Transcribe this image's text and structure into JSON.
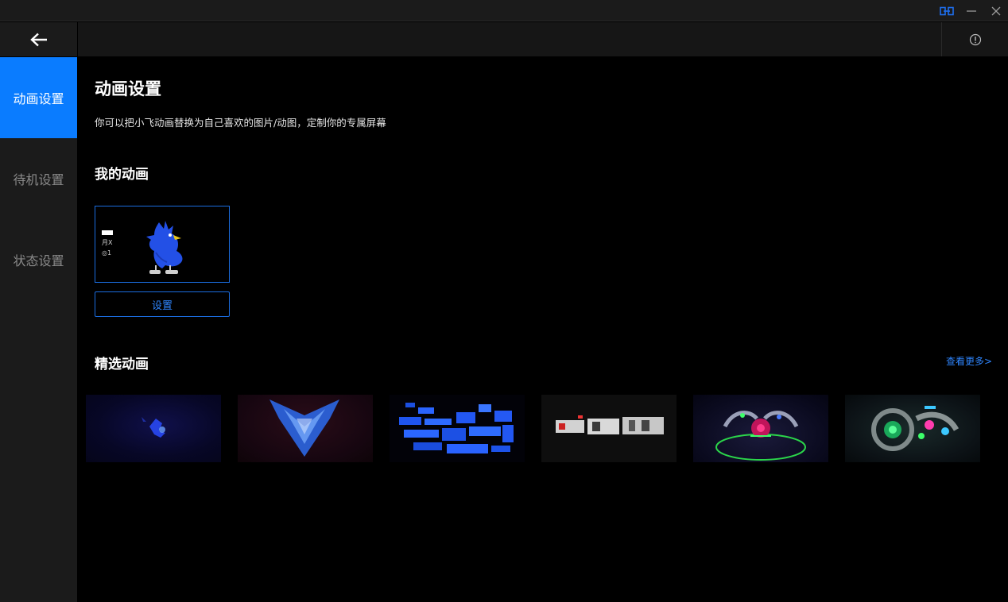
{
  "titlebar": {
    "icons": [
      "link-icon",
      "minimize-icon",
      "close-icon"
    ],
    "accent": "#1e6ff0"
  },
  "header": {
    "back_icon": "arrow-left-icon",
    "info_icon": "info-circle-icon"
  },
  "sidebar": {
    "items": [
      {
        "label": "动画设置",
        "active": true
      },
      {
        "label": "待机设置",
        "active": false
      },
      {
        "label": "状态设置",
        "active": false
      }
    ],
    "active_color": "#0a7cff"
  },
  "main": {
    "title": "动画设置",
    "description": "你可以把小飞动画替换为自己喜欢的图片/动图，定制你的专属屏幕",
    "my_animation": {
      "heading": "我的动画",
      "status_line_2": "月X",
      "status_line_3": "◎1",
      "settings_label": "设置"
    },
    "featured": {
      "heading": "精选动画",
      "see_more": "查看更多>",
      "thumbnails": [
        "featured-1",
        "featured-2",
        "featured-3",
        "featured-4",
        "featured-5",
        "featured-6"
      ]
    }
  }
}
